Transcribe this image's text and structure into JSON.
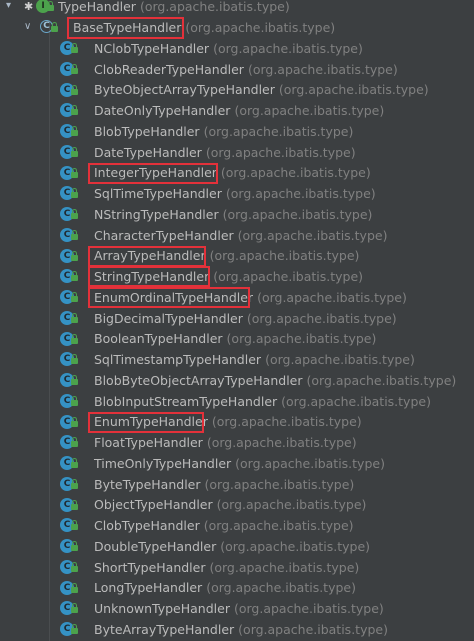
{
  "root": {
    "name": "TypeHandler",
    "package": "(org.apache.ibatis.type)",
    "icon": "interface-icon"
  },
  "base": {
    "name": "BaseTypeHandler",
    "package": "(org.apache.ibatis.type)",
    "icon": "abstract-class-icon"
  },
  "children": [
    {
      "name": "NClobTypeHandler",
      "package": "(org.apache.ibatis.type)",
      "highlighted": false
    },
    {
      "name": "ClobReaderTypeHandler",
      "package": "(org.apache.ibatis.type)",
      "highlighted": false
    },
    {
      "name": "ByteObjectArrayTypeHandler",
      "package": "(org.apache.ibatis.type)",
      "highlighted": false
    },
    {
      "name": "DateOnlyTypeHandler",
      "package": "(org.apache.ibatis.type)",
      "highlighted": false
    },
    {
      "name": "BlobTypeHandler",
      "package": "(org.apache.ibatis.type)",
      "highlighted": false
    },
    {
      "name": "DateTypeHandler",
      "package": "(org.apache.ibatis.type)",
      "highlighted": false
    },
    {
      "name": "IntegerTypeHandler",
      "package": "(org.apache.ibatis.type)",
      "highlighted": true
    },
    {
      "name": "SqlTimeTypeHandler",
      "package": "(org.apache.ibatis.type)",
      "highlighted": false
    },
    {
      "name": "NStringTypeHandler",
      "package": "(org.apache.ibatis.type)",
      "highlighted": false
    },
    {
      "name": "CharacterTypeHandler",
      "package": "(org.apache.ibatis.type)",
      "highlighted": false
    },
    {
      "name": "ArrayTypeHandler",
      "package": "(org.apache.ibatis.type)",
      "highlighted": true
    },
    {
      "name": "StringTypeHandler",
      "package": "(org.apache.ibatis.type)",
      "highlighted": true
    },
    {
      "name": "EnumOrdinalTypeHandler",
      "package": "(org.apache.ibatis.type)",
      "highlighted": true
    },
    {
      "name": "BigDecimalTypeHandler",
      "package": "(org.apache.ibatis.type)",
      "highlighted": false
    },
    {
      "name": "BooleanTypeHandler",
      "package": "(org.apache.ibatis.type)",
      "highlighted": false
    },
    {
      "name": "SqlTimestampTypeHandler",
      "package": "(org.apache.ibatis.type)",
      "highlighted": false
    },
    {
      "name": "BlobByteObjectArrayTypeHandler",
      "package": "(org.apache.ibatis.type)",
      "highlighted": false
    },
    {
      "name": "BlobInputStreamTypeHandler",
      "package": "(org.apache.ibatis.type)",
      "highlighted": false
    },
    {
      "name": "EnumTypeHandler",
      "package": "(org.apache.ibatis.type)",
      "highlighted": true
    },
    {
      "name": "FloatTypeHandler",
      "package": "(org.apache.ibatis.type)",
      "highlighted": false
    },
    {
      "name": "TimeOnlyTypeHandler",
      "package": "(org.apache.ibatis.type)",
      "highlighted": false
    },
    {
      "name": "ByteTypeHandler",
      "package": "(org.apache.ibatis.type)",
      "highlighted": false
    },
    {
      "name": "ObjectTypeHandler",
      "package": "(org.apache.ibatis.type)",
      "highlighted": false
    },
    {
      "name": "ClobTypeHandler",
      "package": "(org.apache.ibatis.type)",
      "highlighted": false
    },
    {
      "name": "DoubleTypeHandler",
      "package": "(org.apache.ibatis.type)",
      "highlighted": false
    },
    {
      "name": "ShortTypeHandler",
      "package": "(org.apache.ibatis.type)",
      "highlighted": false
    },
    {
      "name": "LongTypeHandler",
      "package": "(org.apache.ibatis.type)",
      "highlighted": false
    },
    {
      "name": "UnknownTypeHandler",
      "package": "(org.apache.ibatis.type)",
      "highlighted": false
    },
    {
      "name": "ByteArrayTypeHandler",
      "package": "(org.apache.ibatis.type)",
      "highlighted": false
    }
  ],
  "icons": {
    "class": "class-icon",
    "lock": "lock-icon",
    "expand": "chevron-down-icon"
  },
  "colors": {
    "background": "#3c3f41",
    "text": "#bbbbbb",
    "package": "#808080",
    "highlight": "#e3313a",
    "classIcon": "#3592c4"
  }
}
